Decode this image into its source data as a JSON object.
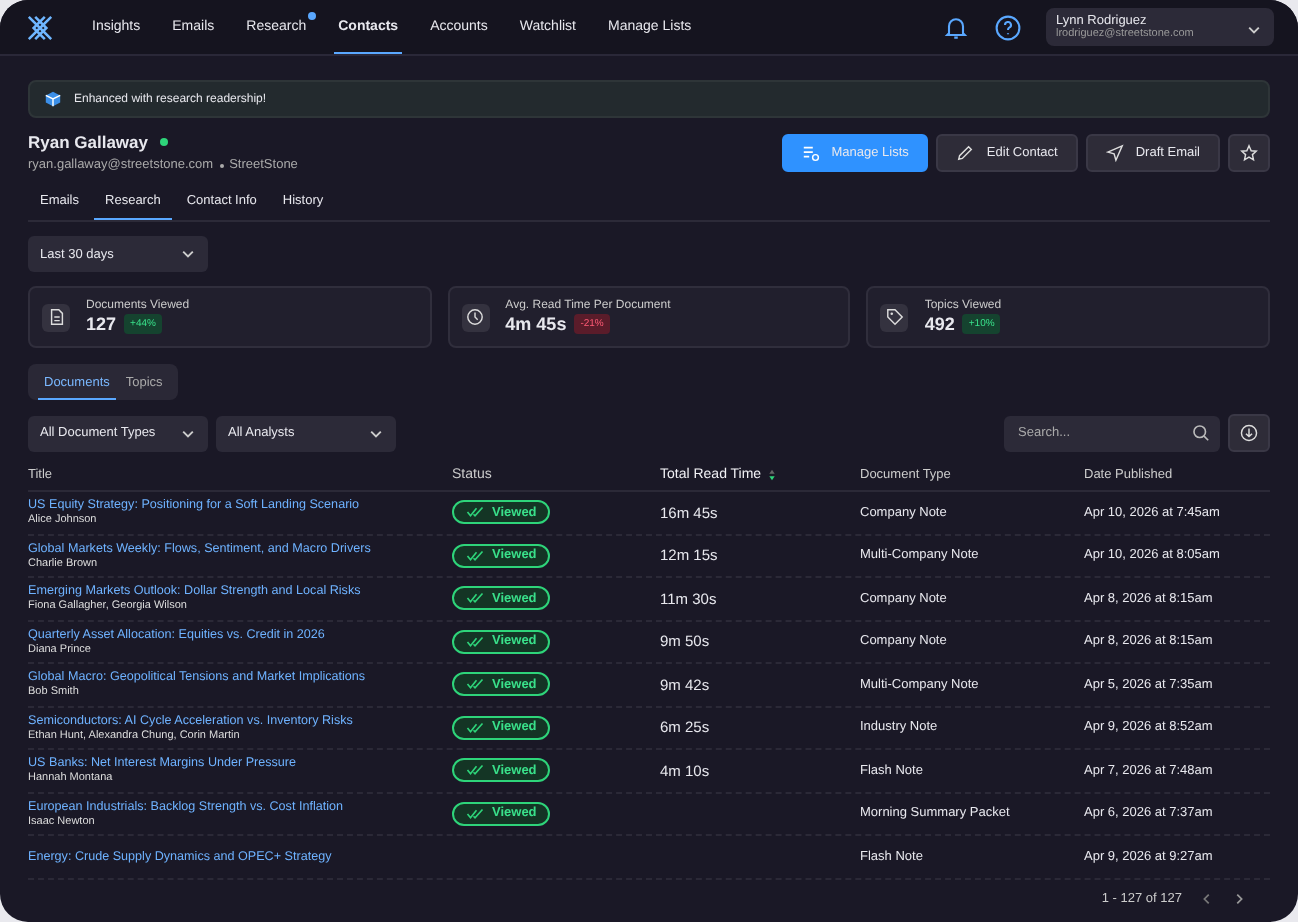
{
  "nav": {
    "items": [
      {
        "label": "Insights",
        "selected": false,
        "dot": false
      },
      {
        "label": "Emails",
        "selected": false,
        "dot": false
      },
      {
        "label": "Research",
        "selected": false,
        "dot": true
      },
      {
        "label": "Contacts",
        "selected": true,
        "dot": false
      },
      {
        "label": "Accounts",
        "selected": false,
        "dot": false
      },
      {
        "label": "Watchlist",
        "selected": false,
        "dot": false
      },
      {
        "label": "Manage Lists",
        "selected": false,
        "dot": false
      }
    ],
    "user": {
      "name": "Lynn Rodriguez",
      "email": "lrodriguez@streetstone.com"
    }
  },
  "banner": "Enhanced with research readership!",
  "contact": {
    "name": "Ryan Gallaway",
    "online": true,
    "email": "ryan.gallaway@streetstone.com",
    "company": "StreetStone"
  },
  "actions": [
    {
      "label": "Manage Lists",
      "kind": "primary"
    },
    {
      "label": "Edit Contact",
      "kind": "secondary"
    },
    {
      "label": "Draft Email",
      "kind": "secondary"
    }
  ],
  "tabs": [
    {
      "label": "Emails",
      "selected": false
    },
    {
      "label": "Research",
      "selected": true
    },
    {
      "label": "Contact Info",
      "selected": false
    },
    {
      "label": "History",
      "selected": false
    }
  ],
  "range": "Last 30 days",
  "stats": [
    {
      "label": "Documents Viewed",
      "value": "127",
      "change": "+44%",
      "kind": "up"
    },
    {
      "label": "Avg. Read Time Per Document",
      "value": "4m 45s",
      "change": "-21%",
      "kind": "down"
    },
    {
      "label": "Topics Viewed",
      "value": "492",
      "change": "+10%",
      "kind": "up"
    }
  ],
  "view_tabs": [
    {
      "label": "Documents",
      "selected": true
    },
    {
      "label": "Topics",
      "selected": false
    }
  ],
  "filters": [
    "All Document Types",
    "All Analysts"
  ],
  "search": {
    "placeholder": "Search..."
  },
  "table": {
    "columns": [
      {
        "label": "Title",
        "sorted": false
      },
      {
        "label": "Status",
        "sorted": false
      },
      {
        "label": "Total Read Time",
        "sorted": true
      },
      {
        "label": "Document Type",
        "sorted": false
      },
      {
        "label": "Date Published",
        "sorted": false
      }
    ],
    "rows": [
      {
        "title": "US Equity Strategy: Positioning for a Soft Landing Scenario",
        "authors": "Alice Johnson",
        "status": "Viewed",
        "read_time": "16m 45s",
        "type": "Company Note",
        "date": "Apr 10, 2026 at 7:45am"
      },
      {
        "title": "Global Markets Weekly: Flows, Sentiment, and Macro Drivers",
        "authors": "Charlie Brown",
        "status": "Viewed",
        "read_time": "12m 15s",
        "type": "Multi-Company Note",
        "date": "Apr 10, 2026 at 8:05am"
      },
      {
        "title": "Emerging Markets Outlook: Dollar Strength and Local Risks",
        "authors": "Fiona Gallagher, Georgia Wilson",
        "status": "Viewed",
        "read_time": "11m 30s",
        "type": "Company Note",
        "date": "Apr 8, 2026 at 8:15am"
      },
      {
        "title": "Quarterly Asset Allocation: Equities vs. Credit in 2026",
        "authors": "Diana Prince",
        "status": "Viewed",
        "read_time": "9m 50s",
        "type": "Company Note",
        "date": "Apr 8, 2026 at 8:15am"
      },
      {
        "title": "Global Macro: Geopolitical Tensions and Market Implications",
        "authors": "Bob Smith",
        "status": "Viewed",
        "read_time": "9m 42s",
        "type": "Multi-Company Note",
        "date": "Apr 5, 2026 at 7:35am"
      },
      {
        "title": "Semiconductors: AI Cycle Acceleration vs. Inventory Risks",
        "authors": "Ethan Hunt, Alexandra Chung, Corin Martin",
        "status": "Viewed",
        "read_time": "6m 25s",
        "type": "Industry Note",
        "date": "Apr 9, 2026 at 8:52am"
      },
      {
        "title": "US Banks: Net Interest Margins Under Pressure",
        "authors": "Hannah Montana",
        "status": "Viewed",
        "read_time": "4m 10s",
        "type": "Flash Note",
        "date": "Apr 7, 2026 at 7:48am"
      },
      {
        "title": "European Industrials: Backlog Strength vs. Cost Inflation",
        "authors": "Isaac Newton",
        "status": "Viewed",
        "type": "Morning Summary Packet",
        "date": "Apr 6, 2026 at 7:37am"
      },
      {
        "title": "Energy: Crude Supply Dynamics and OPEC+ Strategy",
        "type": "Flash Note",
        "date": "Apr 9, 2026 at 9:27am"
      }
    ]
  },
  "pagination": "1 - 127 of 127"
}
